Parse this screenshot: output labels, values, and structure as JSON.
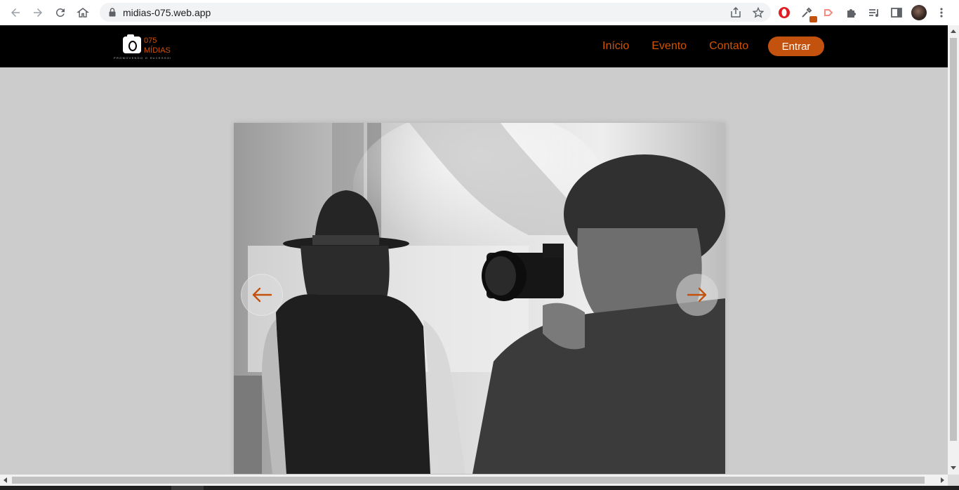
{
  "browser": {
    "url": "midias-075.web.app",
    "icons": {
      "back": "arrow-left-icon",
      "forward": "arrow-right-icon",
      "reload": "reload-icon",
      "home": "home-icon",
      "lock": "lock-icon",
      "share": "share-icon",
      "bookmark": "star-icon",
      "extensions": [
        "opera-icon",
        "eyedropper-icon",
        "cast-icon",
        "puzzle-icon",
        "reading-list-icon",
        "side-panel-icon"
      ],
      "menu": "kebab-menu-icon"
    }
  },
  "site": {
    "logo": {
      "line1": "075",
      "line2": "MÍDIAS",
      "tagline": "PROMOVENDO O SUCESSO!"
    },
    "nav": [
      {
        "label": "Início"
      },
      {
        "label": "Evento"
      },
      {
        "label": "Contato"
      }
    ],
    "login_label": "Entrar",
    "accent": "#d35400",
    "header_bg": "#000000",
    "page_bg": "#cccccc"
  },
  "carousel": {
    "image": "black-and-white-photographer-scene",
    "prev_icon": "arrow-left-icon",
    "next_icon": "arrow-right-icon"
  }
}
